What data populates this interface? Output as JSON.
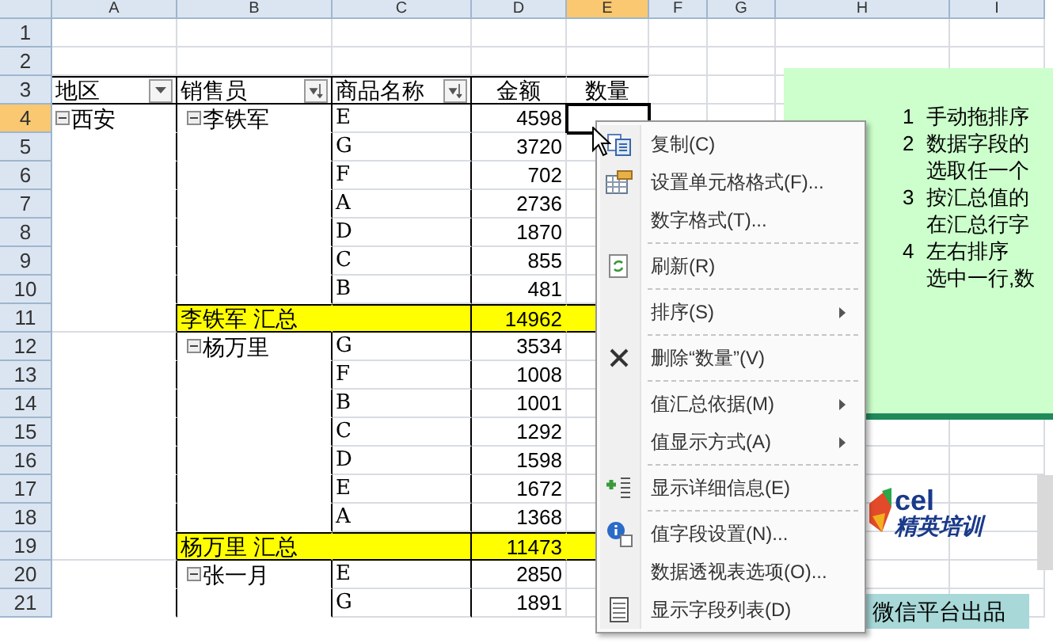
{
  "columns": [
    {
      "label": "A",
      "selected": false
    },
    {
      "label": "B",
      "selected": false
    },
    {
      "label": "C",
      "selected": false
    },
    {
      "label": "D",
      "selected": false
    },
    {
      "label": "E",
      "selected": true
    },
    {
      "label": "F",
      "selected": false
    },
    {
      "label": "G",
      "selected": false
    },
    {
      "label": "H",
      "selected": false
    },
    {
      "label": "I",
      "selected": false
    }
  ],
  "row_numbers": [
    {
      "label": "1",
      "selected": false
    },
    {
      "label": "2",
      "selected": false
    },
    {
      "label": "3",
      "selected": false
    },
    {
      "label": "4",
      "selected": true
    },
    {
      "label": "5",
      "selected": false
    },
    {
      "label": "6",
      "selected": false
    },
    {
      "label": "7",
      "selected": false
    },
    {
      "label": "8",
      "selected": false
    },
    {
      "label": "9",
      "selected": false
    },
    {
      "label": "10",
      "selected": false
    },
    {
      "label": "11",
      "selected": false
    },
    {
      "label": "12",
      "selected": false
    },
    {
      "label": "13",
      "selected": false
    },
    {
      "label": "14",
      "selected": false
    },
    {
      "label": "15",
      "selected": false
    },
    {
      "label": "16",
      "selected": false
    },
    {
      "label": "17",
      "selected": false
    },
    {
      "label": "18",
      "selected": false
    },
    {
      "label": "19",
      "selected": false
    },
    {
      "label": "20",
      "selected": false
    },
    {
      "label": "21",
      "selected": false
    }
  ],
  "pivot": {
    "headers": [
      {
        "label": "地区",
        "kind": "filter"
      },
      {
        "label": "销售员",
        "kind": "sorted"
      },
      {
        "label": "商品名称",
        "kind": "sorted"
      },
      {
        "label": "金额",
        "kind": "value"
      },
      {
        "label": "数量",
        "kind": "value"
      }
    ],
    "regions": [
      {
        "name": "西安",
        "expanded": true,
        "sellers": [
          {
            "name": "李铁军",
            "expanded": true,
            "items": [
              {
                "product": "E",
                "amount": "4598"
              },
              {
                "product": "G",
                "amount": "3720"
              },
              {
                "product": "F",
                "amount": "702"
              },
              {
                "product": "A",
                "amount": "2736"
              },
              {
                "product": "D",
                "amount": "1870"
              },
              {
                "product": "C",
                "amount": "855"
              },
              {
                "product": "B",
                "amount": "481"
              }
            ],
            "subtotal_label": "李铁军  汇总",
            "subtotal": "14962"
          },
          {
            "name": "杨万里",
            "expanded": true,
            "items": [
              {
                "product": "G",
                "amount": "3534"
              },
              {
                "product": "F",
                "amount": "1008"
              },
              {
                "product": "B",
                "amount": "1001"
              },
              {
                "product": "C",
                "amount": "1292"
              },
              {
                "product": "D",
                "amount": "1598"
              },
              {
                "product": "E",
                "amount": "1672"
              },
              {
                "product": "A",
                "amount": "1368"
              }
            ],
            "subtotal_label": "杨万里  汇总",
            "subtotal": "11473"
          },
          {
            "name": "张一月",
            "expanded": true,
            "items": [
              {
                "product": "E",
                "amount": "2850"
              },
              {
                "product": "G",
                "amount": "1891"
              }
            ]
          }
        ]
      }
    ]
  },
  "notes": [
    {
      "number": "1",
      "text": "手动拖排序"
    },
    {
      "number": "2",
      "text": "数据字段的"
    },
    {
      "text": "选取任一个"
    },
    {
      "number": "3",
      "text": "按汇总值的"
    },
    {
      "text": "在汇总行字"
    },
    {
      "number": "4",
      "text": "左右排序"
    },
    {
      "text": "选中一行,数"
    }
  ],
  "logo": {
    "text_top": "cel",
    "text_bottom": "精英培训"
  },
  "footer_banner": "微信平台出品",
  "context_menu": [
    {
      "label": "复制(C)",
      "submenu": false,
      "separator_after": false
    },
    {
      "label": "设置单元格格式(F)...",
      "submenu": false,
      "separator_after": false
    },
    {
      "label": "数字格式(T)...",
      "submenu": false,
      "separator_after": true
    },
    {
      "label": "刷新(R)",
      "submenu": false,
      "separator_after": true
    },
    {
      "label": "排序(S)",
      "submenu": true,
      "separator_after": true
    },
    {
      "label": "删除“数量”(V)",
      "submenu": false,
      "separator_after": true
    },
    {
      "label": "值汇总依据(M)",
      "submenu": true,
      "separator_after": false
    },
    {
      "label": "值显示方式(A)",
      "submenu": true,
      "separator_after": true
    },
    {
      "label": "显示详细信息(E)",
      "submenu": false,
      "separator_after": true
    },
    {
      "label": "值字段设置(N)...",
      "submenu": false,
      "separator_after": false
    },
    {
      "label": "数据透视表选项(O)...",
      "submenu": false,
      "separator_after": false
    },
    {
      "label": "显示字段列表(D)",
      "submenu": false,
      "separator_after": false
    }
  ]
}
